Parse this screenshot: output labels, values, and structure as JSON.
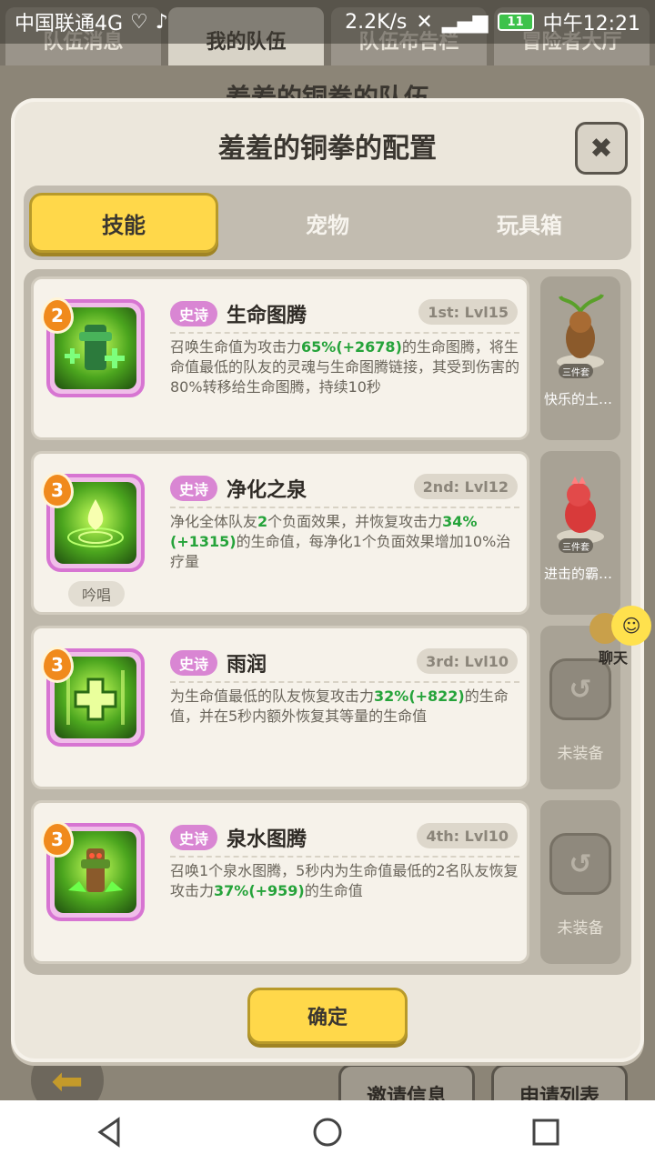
{
  "status_bar": {
    "carrier": "中国联通4G",
    "speed": "2.2K/s",
    "battery": "11",
    "time": "中午12:21"
  },
  "background": {
    "tabs": [
      "队伍消息",
      "我的队伍",
      "队伍布告栏",
      "冒险者大厅"
    ],
    "team_title": "羞羞的铜拳的队伍",
    "buttons": {
      "invite": "邀请信息",
      "apply": "申请列表"
    }
  },
  "modal": {
    "title": "羞羞的铜拳的配置",
    "tabs": [
      "技能",
      "宠物",
      "玩具箱"
    ],
    "confirm_label": "确定",
    "skills": [
      {
        "level": "2",
        "rarity": "史诗",
        "name": "生命图腾",
        "slot": "1st: Lvl15",
        "desc_parts": [
          "召唤生命值为攻击力",
          "65%(+2678)",
          "的生命图腾，将生命值最低的队友的灵魂与生命图腾链接，其受到伤害的80%转移给生命图腾，持续10秒"
        ]
      },
      {
        "level": "3",
        "rarity": "史诗",
        "name": "净化之泉",
        "slot": "2nd: Lvl12",
        "tag": "吟唱",
        "desc_parts": [
          "净化全体队友",
          "2",
          "个负面效果，并恢复攻击力",
          "34%(+1315)",
          "的生命值，每净化1个负面效果增加10%治疗量"
        ]
      },
      {
        "level": "3",
        "rarity": "史诗",
        "name": "雨润",
        "slot": "3rd: Lvl10",
        "desc_parts": [
          "为生命值最低的队友恢复攻击力",
          "32%(+822)",
          "的生命值，并在5秒内额外恢复其等量的生命值"
        ]
      },
      {
        "level": "3",
        "rarity": "史诗",
        "name": "泉水图腾",
        "slot": "4th: Lvl10",
        "desc_parts": [
          "召唤1个泉水图腾，5秒内为生命值最低的2名队友恢复攻击力",
          "37%(+959)",
          "的生命值"
        ]
      }
    ],
    "equipment": [
      {
        "name": "快乐的土…",
        "set": "三件套",
        "color": "#8b5a2b"
      },
      {
        "name": "进击的霸…",
        "set": "三件套",
        "color": "#d83a3a"
      },
      {
        "empty_label": "未装备"
      },
      {
        "empty_label": "未装备"
      }
    ]
  },
  "chat": {
    "label": "聊天"
  }
}
